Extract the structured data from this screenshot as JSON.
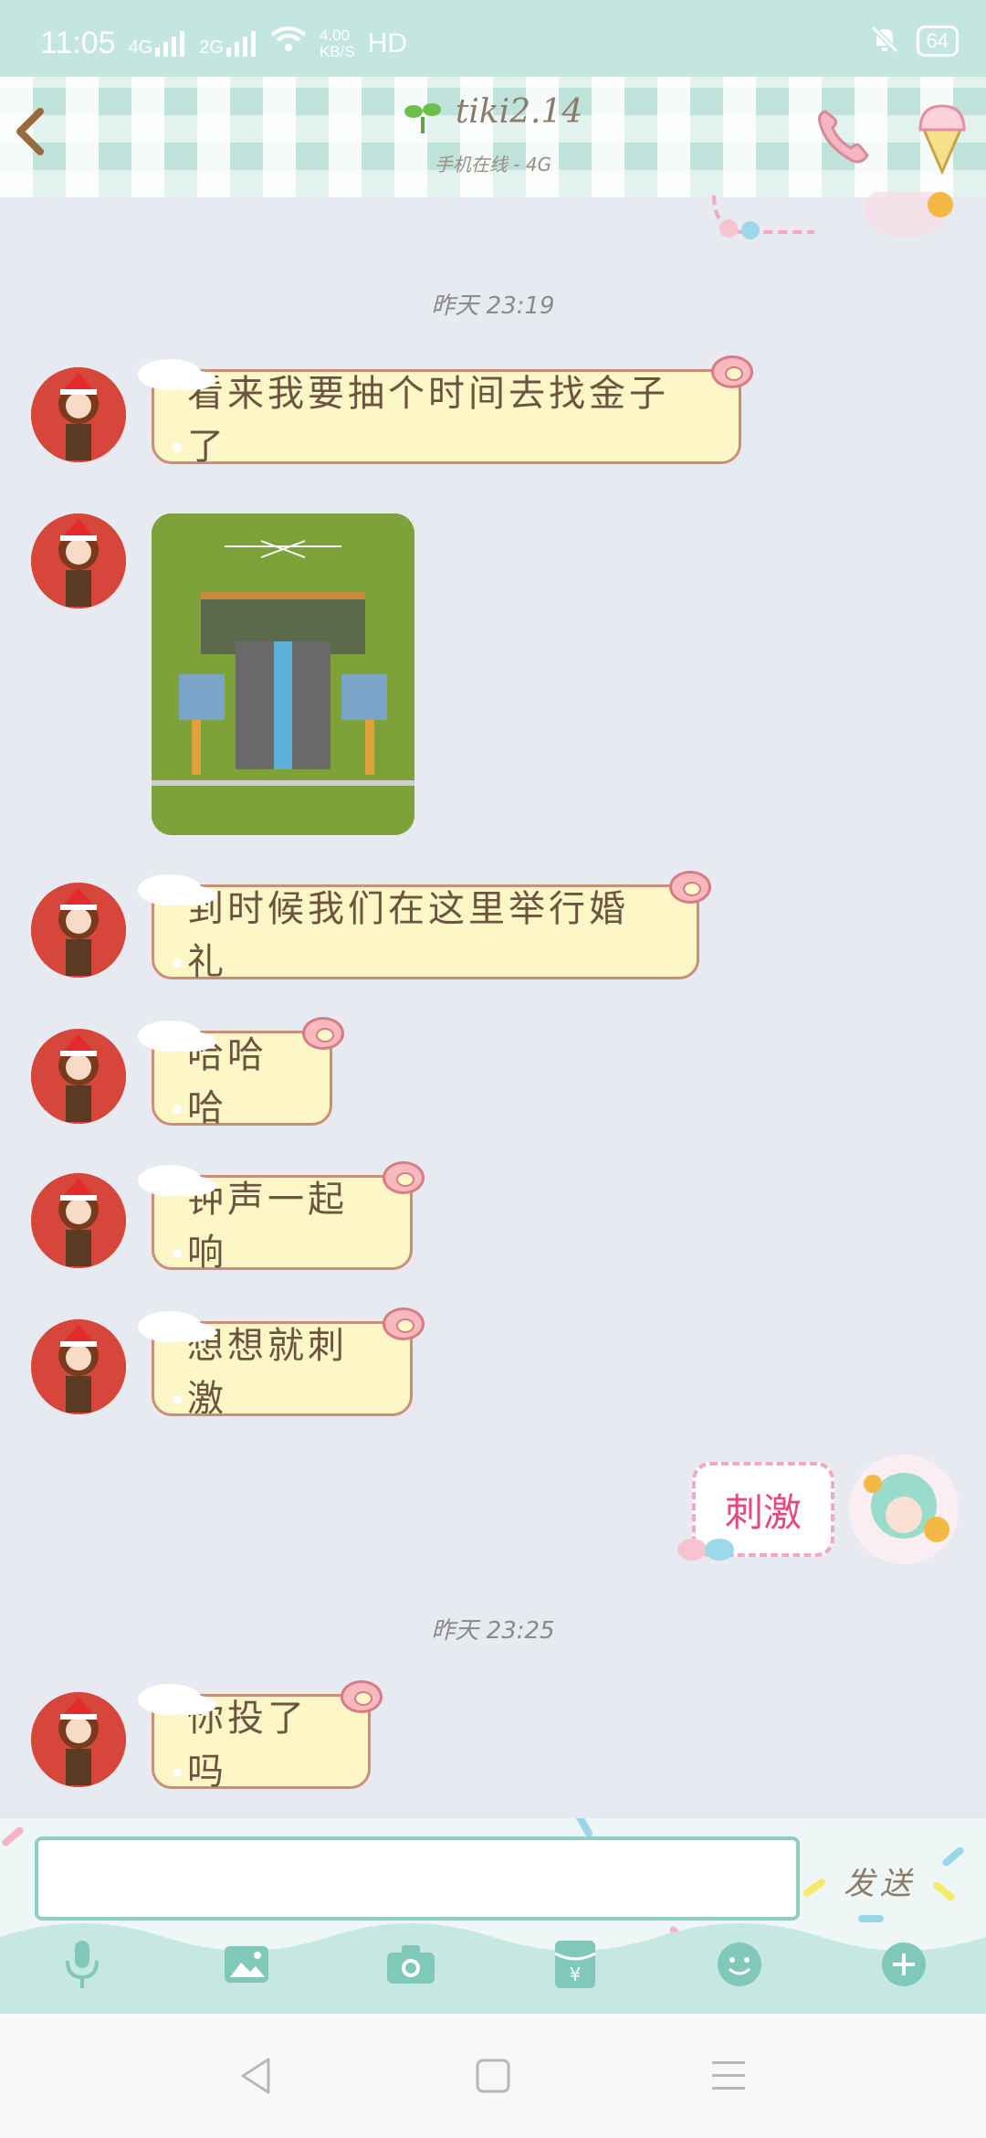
{
  "status_bar": {
    "time": "11:05",
    "net_4g": "4G",
    "net_2g": "2G",
    "speed": "4.00",
    "speed_unit": "KB/S",
    "hd": "HD",
    "battery": "64"
  },
  "header": {
    "contact_name": "tiki2.14",
    "status": "手机在线 - 4G"
  },
  "chat": {
    "time_1": "昨天 23:19",
    "time_2": "昨天 23:25",
    "msg_1": "看来我要抽个时间去找金子了",
    "msg_3": "到时候我们在这里举行婚礼",
    "msg_4": "哈哈哈",
    "msg_5": "钟声一起响",
    "msg_6": "想想就刺激",
    "sticker_text": "刺激",
    "msg_7": "你投了吗"
  },
  "input": {
    "placeholder": "",
    "value": "",
    "send_label": "发送"
  },
  "toolbar": {
    "icons": [
      "microphone-icon",
      "image-icon",
      "camera-icon",
      "red-packet-icon",
      "emoji-icon",
      "plus-icon"
    ]
  },
  "colors": {
    "accent": "#8fcfc1",
    "bubble_fill": "#fdf6c7",
    "bubble_border": "#c98f79",
    "background": "#e8eaf2"
  }
}
